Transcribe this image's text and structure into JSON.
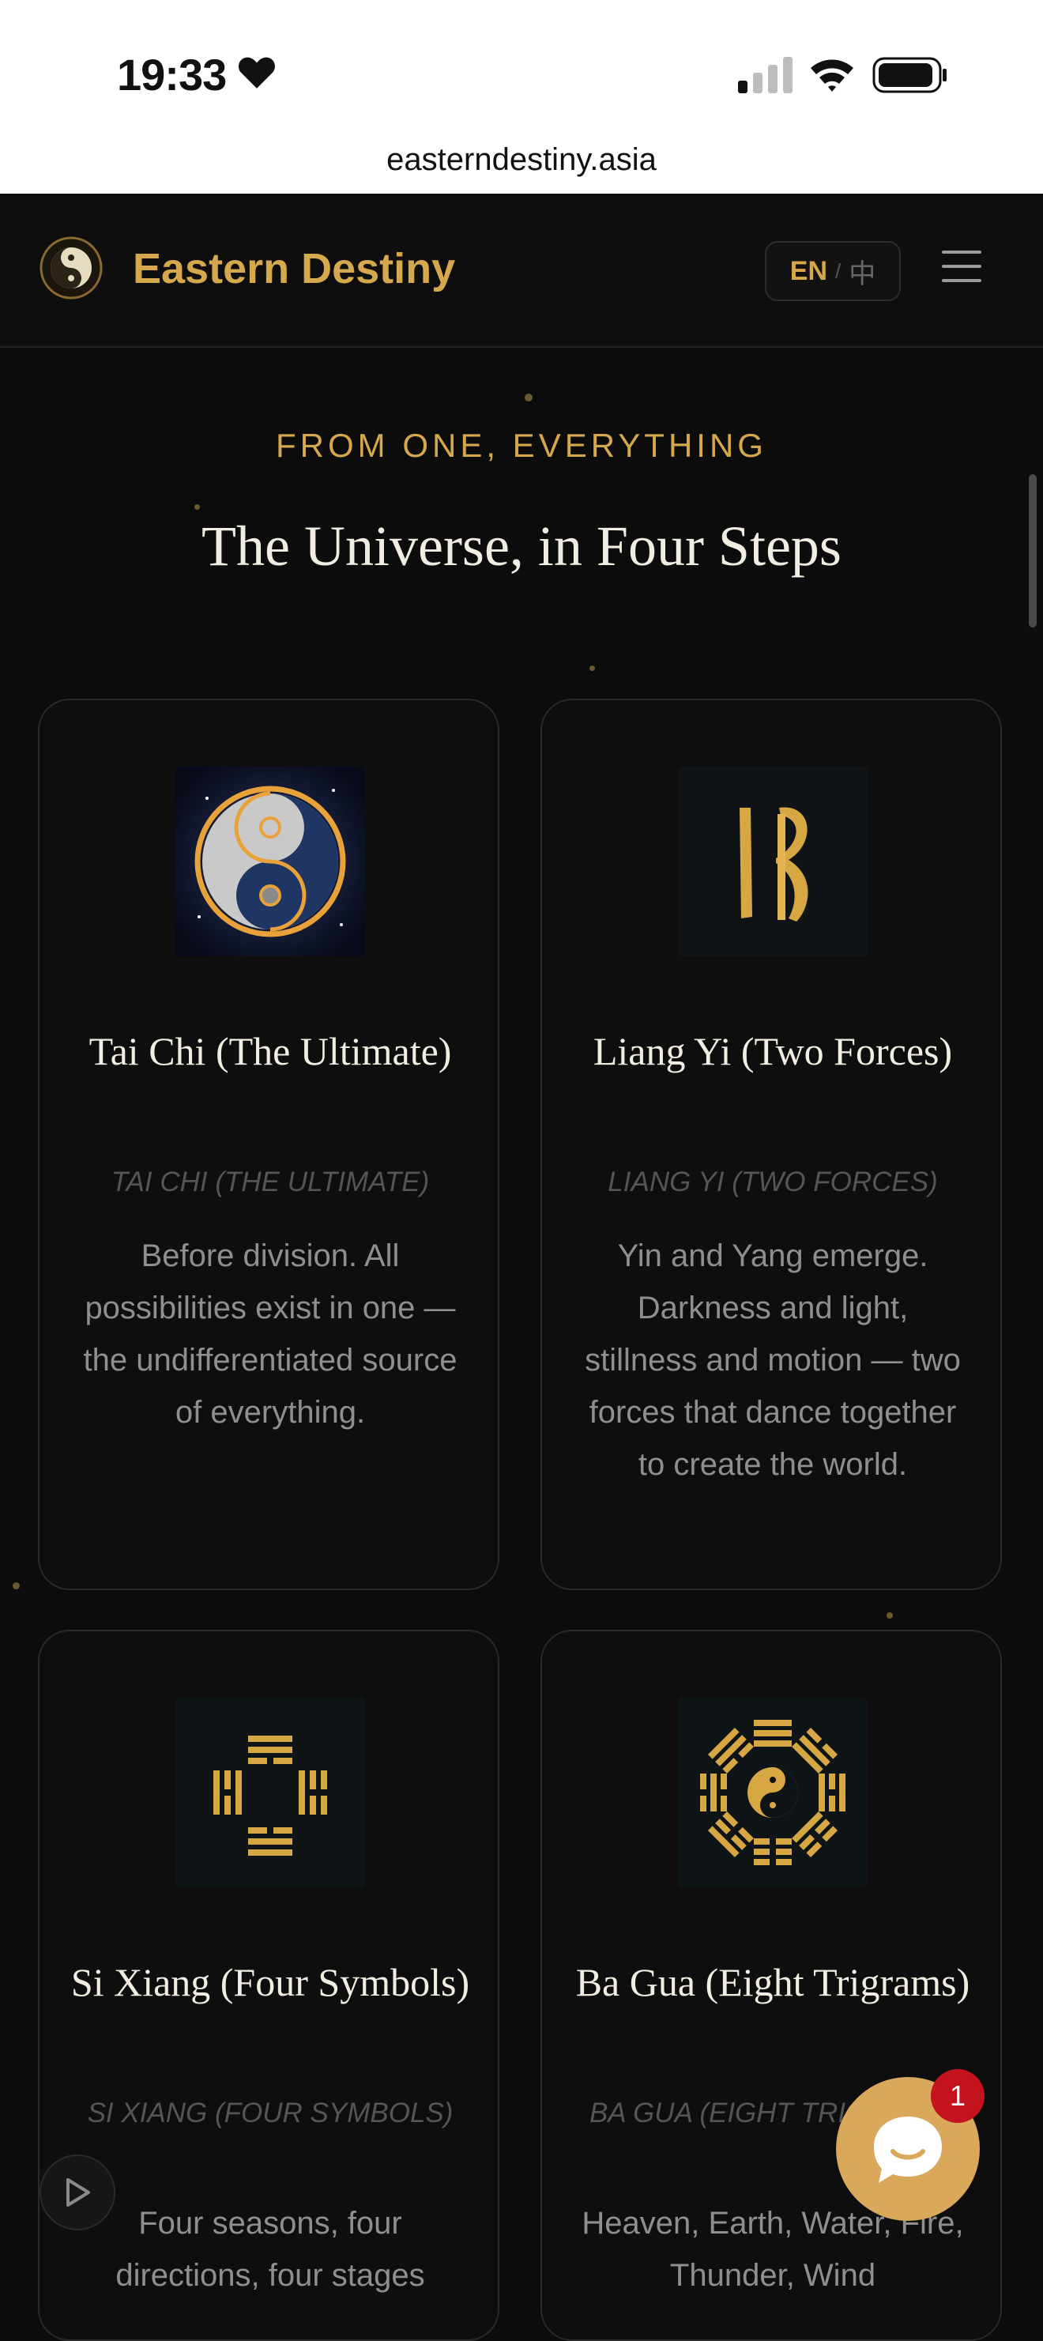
{
  "status_bar": {
    "time": "19:33"
  },
  "browser": {
    "url": "easterndestiny.asia"
  },
  "header": {
    "brand": "Eastern Destiny",
    "lang_en": "EN",
    "lang_sep": "/",
    "lang_zh": "中"
  },
  "hero": {
    "eyebrow": "FROM ONE, EVERYTHING",
    "title": "The Universe, in Four Steps"
  },
  "cards": [
    {
      "icon": "taichi-moon-image",
      "title": "Tai Chi (The Ultimate)",
      "subtitle": "TAI CHI (THE ULTIMATE)",
      "description": "Before division. All possibilities exist in one — the undifferentiated source of everything."
    },
    {
      "icon": "liang-yi-brush-image",
      "title": "Liang Yi (Two Forces)",
      "subtitle": "LIANG YI (TWO FORCES)",
      "description": "Yin and Yang emerge. Darkness and light, stillness and motion — two forces that dance together to create the world."
    },
    {
      "icon": "si-xiang-symbols-image",
      "title": "Si Xiang (Four Symbols)",
      "subtitle": "SI XIANG (FOUR SYMBOLS)",
      "description": "Four seasons, four directions, four stages"
    },
    {
      "icon": "ba-gua-trigrams-image",
      "title": "Ba Gua (Eight Trigrams)",
      "subtitle": "BA GUA (EIGHT TRIGRAMS)",
      "description": "Heaven, Earth, Water, Fire, Thunder, Wind"
    }
  ],
  "chat": {
    "badge_count": "1"
  },
  "colors": {
    "accent": "#d6a84e",
    "background": "#0c0c0c",
    "badge": "#c4121e"
  }
}
